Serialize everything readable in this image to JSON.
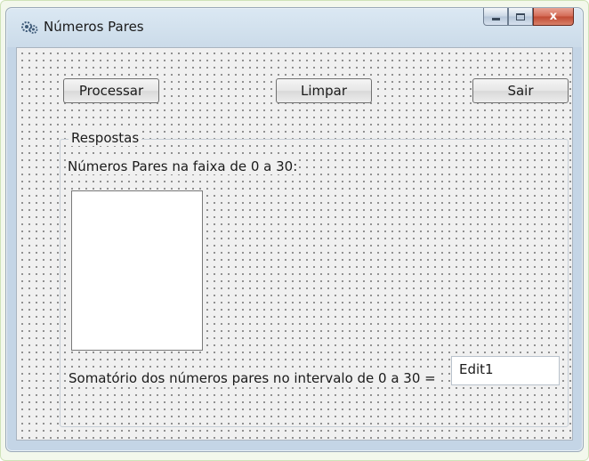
{
  "window": {
    "title": "Números Pares",
    "icon": "gears-app-icon",
    "caption": {
      "minimize": "minimize",
      "maximize": "maximize",
      "close": "x"
    }
  },
  "toolbar": {
    "process_label": "Processar",
    "clear_label": "Limpar",
    "exit_label": "Sair"
  },
  "results": {
    "group_caption": "Respostas",
    "range_label": "Números Pares na faixa de 0 a 30:",
    "sum_label": "Somatório dos números pares no intervalo de 0 a 30 =",
    "sum_value": "Edit1",
    "list_items": []
  },
  "colors": {
    "close_button": "#c04a33",
    "frame": "#c4d5e6"
  }
}
